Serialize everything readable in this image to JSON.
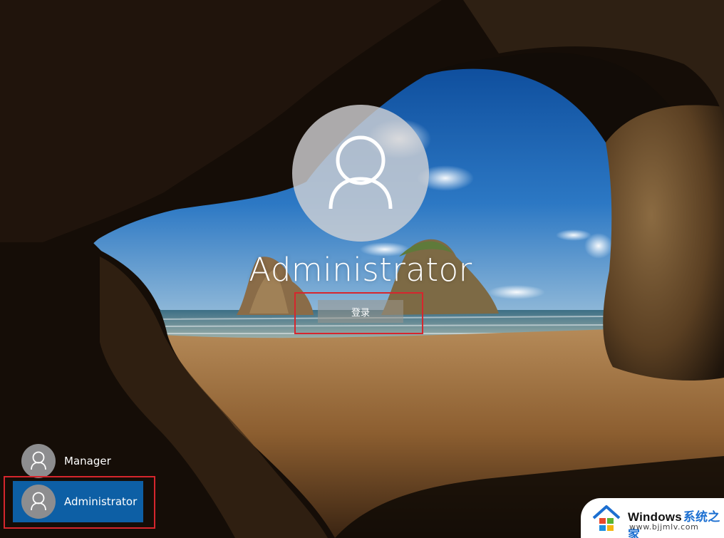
{
  "lock_screen": {
    "current_user": "Administrator",
    "signin_label": "登录"
  },
  "user_list": {
    "items": [
      {
        "label": "Manager",
        "selected": false
      },
      {
        "label": "Administrator",
        "selected": true
      }
    ]
  },
  "watermark": {
    "title": "Windows",
    "title_cn": "系统之家",
    "url": "www.bjjmlv.com"
  },
  "colors": {
    "selection_blue": "#0d5fa5",
    "annotation_red": "#d6262d"
  }
}
